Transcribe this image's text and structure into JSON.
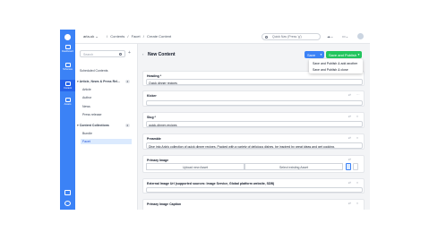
{
  "sidebar": {
    "items": [
      {
        "label": "Dashboard",
        "icon": "home-icon"
      },
      {
        "label": "Schemas",
        "icon": "schema-icon"
      },
      {
        "label": "Content",
        "icon": "content-icon"
      },
      {
        "label": "Assets",
        "icon": "image-icon"
      }
    ]
  },
  "topbar": {
    "locale": "arla-uk",
    "breadcrumbs": [
      "/",
      "Contents",
      "/",
      "Facet",
      "/",
      "Create Content"
    ],
    "search_placeholder": "Quick Nav (Press 'g')"
  },
  "tree": {
    "search_placeholder": "Search",
    "add_symbol": "+",
    "items": [
      {
        "label": "Scheduled Contents",
        "level": 0
      },
      {
        "label": "Article, News & Press Rel...",
        "level": 0,
        "badge": "4",
        "expanded": true
      },
      {
        "label": "Article",
        "level": 1
      },
      {
        "label": "Author",
        "level": 1
      },
      {
        "label": "News",
        "level": 1
      },
      {
        "label": "Press release",
        "level": 1
      },
      {
        "label": "Content Collections",
        "level": 0,
        "badge": "2",
        "expanded": true
      },
      {
        "label": "Bundle",
        "level": 1
      },
      {
        "label": "Facet",
        "level": 1,
        "selected": true
      }
    ]
  },
  "editor": {
    "title": "New Content",
    "back_symbol": "‹",
    "save_label": "Save",
    "publish_label": "Save and Publish",
    "dropdown": [
      "Save and Publish & add another",
      "Save and Publish & close"
    ],
    "fields": [
      {
        "label": "Heading *",
        "value": "Quick dinner recipes"
      },
      {
        "label": "Kicker",
        "value": ""
      },
      {
        "label": "Slug *",
        "value": "quick-dinner-recipes"
      },
      {
        "label": "Preamble",
        "value": "Dive into Arla's collection of quick dinner recipes. Packed with a variety of delicious dishes, be inspired by great ideas and get cooking."
      },
      {
        "label": "Primary Image",
        "upload": "Upload new Asset",
        "select": "Select existing Asset"
      },
      {
        "label": "External Image Url (supported sources: Image Service, Global platform website, SDB)",
        "value": ""
      },
      {
        "label": "Primary Image Caption",
        "value": ""
      }
    ]
  },
  "colors": {
    "rail": "#3b82f6",
    "save_button": "#3b82f6",
    "publish_button": "#22c55e",
    "selected_tree_bg": "#dbeafe"
  }
}
